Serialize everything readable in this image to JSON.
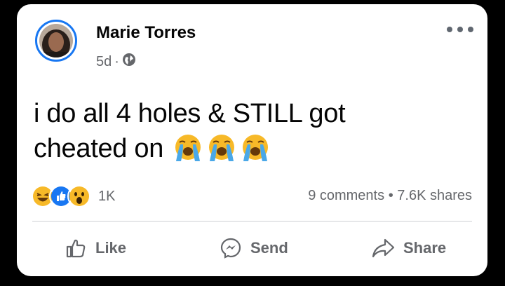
{
  "post": {
    "author": "Marie Torres",
    "time": "5d",
    "separator": "·",
    "privacy_icon": "globe-icon",
    "text_line1": "i do all 4 holes & STILL got",
    "text_line2": "cheated on",
    "emojis": [
      "loudly-crying-face",
      "loudly-crying-face",
      "loudly-crying-face"
    ]
  },
  "engagement": {
    "reactions": [
      "laugh-reaction-icon",
      "like-reaction-icon",
      "wow-reaction-icon"
    ],
    "reaction_count": "1K",
    "comments": "9 comments",
    "dot": "•",
    "shares": "7.6K shares"
  },
  "actions": {
    "like": "Like",
    "send": "Send",
    "share": "Share"
  },
  "colors": {
    "brand": "#1877f2",
    "text": "#050505",
    "muted": "#65676b"
  }
}
